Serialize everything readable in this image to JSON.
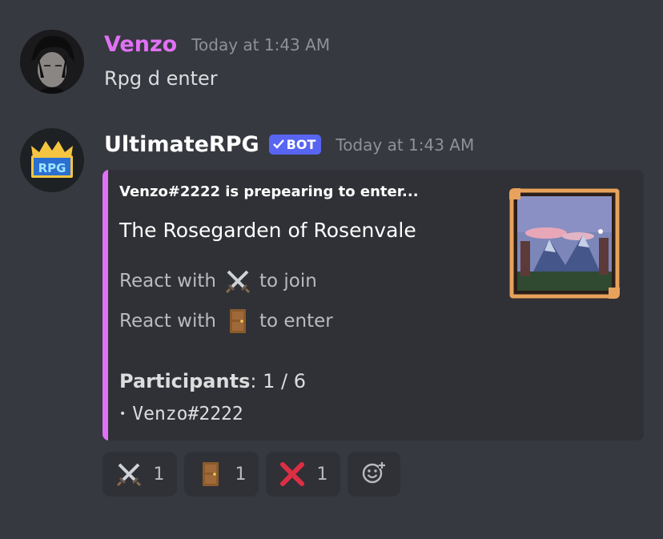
{
  "colors": {
    "background": "#36393f",
    "embed_background": "#2f3136",
    "embed_accent": "#e071f4",
    "venzo_name": "#e071f4",
    "bot_tag": "#5865f2",
    "timestamp": "#8e9297"
  },
  "messages": [
    {
      "username": "Venzo",
      "timestamp": "Today at 1:43 AM",
      "content": "Rpg d enter",
      "avatar_icon": "user-avatar-dark-hair"
    },
    {
      "username": "UltimateRPG",
      "bot_tag": "BOT",
      "timestamp": "Today at 1:43 AM",
      "avatar_icon": "rpg-logo"
    }
  ],
  "embed": {
    "author": "Venzo#2222 is prepearing to enter...",
    "title": "The Rosegarden of Rosenvale",
    "lines": [
      {
        "before": "React with",
        "emoji": "crossed-swords-icon",
        "after": "to join"
      },
      {
        "before": "React with",
        "emoji": "door-icon",
        "after": "to enter"
      }
    ],
    "participants_label": "Participants",
    "participants_value": ": 1 / 6",
    "participant_list": [
      "Venzo#2222"
    ],
    "thumbnail": "pixel-art-mountain-landscape"
  },
  "reactions": [
    {
      "emoji": "crossed-swords-icon",
      "count": "1"
    },
    {
      "emoji": "door-icon",
      "count": "1"
    },
    {
      "emoji": "red-x-icon",
      "count": "1"
    }
  ],
  "add_reaction_icon": "add-reaction-smiley-icon"
}
